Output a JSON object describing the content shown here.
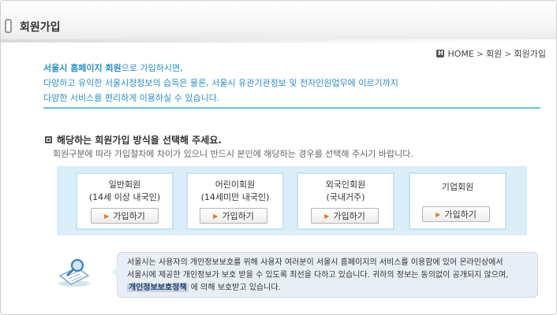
{
  "header": {
    "title": "회원가입"
  },
  "breadcrumb": {
    "home_icon": "H",
    "home": "HOME",
    "sep": ">",
    "level1": "회원",
    "level2": "회원가입"
  },
  "intro": {
    "bold": "서울시 홈페이지 회원",
    "line1_rest": "으로 가입하시면,",
    "line2": "다양하고 유익한 서울시정정보의 습득은 물론, 서울시 유관기관정보 및 전자민원업무에 이르기까지",
    "line3": "다양한 서비스를 편리하게 이용하실 수 있습니다."
  },
  "section": {
    "title": "해당하는 회원가입 방식을 선택해 주세요.",
    "desc": "회원구분에 따라 가입절차에 차이가 있으니 반드시 본인에 해당하는 경우를 선택해 주시기 바랍니다."
  },
  "cards": [
    {
      "name": "일반회원",
      "sub": "(14세 이상 내국인)",
      "button": "가입하기"
    },
    {
      "name": "어린이회원",
      "sub": "(14세미만 내국인)",
      "button": "가입하기"
    },
    {
      "name": "외국인회원",
      "sub": "(국내거주)",
      "button": "가입하기"
    },
    {
      "name": "기업회원",
      "sub": "",
      "button": "가입하기"
    }
  ],
  "notice": {
    "line1": "서울시는 사용자의 개인정보보호를 위해 사용자 여러분이 서울시 홈페이지의 서비스를 이용함에 있어 온라인상에서",
    "line2": "서울시에 제공한 개인정보가 보호 받을 수 있도록 최선을 다하고 있습니다. 귀하의 정보는 동의없이 공개되지 않으며,",
    "link": "개인정보보호정책",
    "line3_rest": "에 의해 보호받고 있습니다."
  },
  "colors": {
    "accent": "#2a8fc4",
    "divider": "#6fc1e5",
    "card_bg": "#d9eef8",
    "button_arrow": "#e07a1f"
  }
}
